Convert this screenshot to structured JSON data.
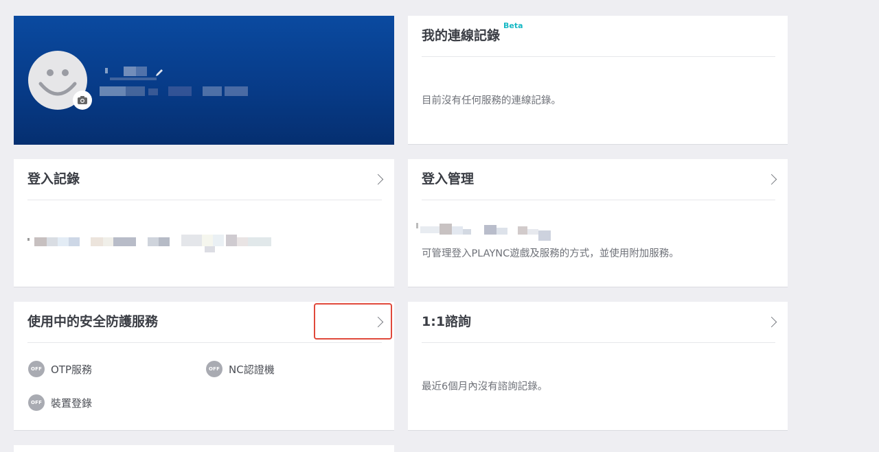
{
  "profile": {
    "avatar_icon": "smiley-face-icon",
    "camera_icon": "camera-icon",
    "edit_icon": "pencil-icon"
  },
  "connection_record": {
    "title": "我的連線記錄",
    "badge": "Beta",
    "empty_text": "目前沒有任何服務的連線記錄。"
  },
  "login_record": {
    "title": "登入記錄"
  },
  "login_management": {
    "title": "登入管理",
    "description": "可管理登入PLAYNC遊戲及服務的方式，並使用附加服務。"
  },
  "security_services": {
    "title": "使用中的安全防護服務",
    "items": [
      {
        "status": "OFF",
        "label": "OTP服務"
      },
      {
        "status": "OFF",
        "label": "NC認證機"
      },
      {
        "status": "OFF",
        "label": "裝置登錄"
      }
    ]
  },
  "inquiry": {
    "title": "1:1諮詢",
    "empty_text": "最近6個月內沒有諮詢記錄。"
  },
  "colors": {
    "profile_bg": "#073a86",
    "beta": "#16b8c4",
    "off_badge": "#a9abb2",
    "highlight": "#e0483a"
  }
}
